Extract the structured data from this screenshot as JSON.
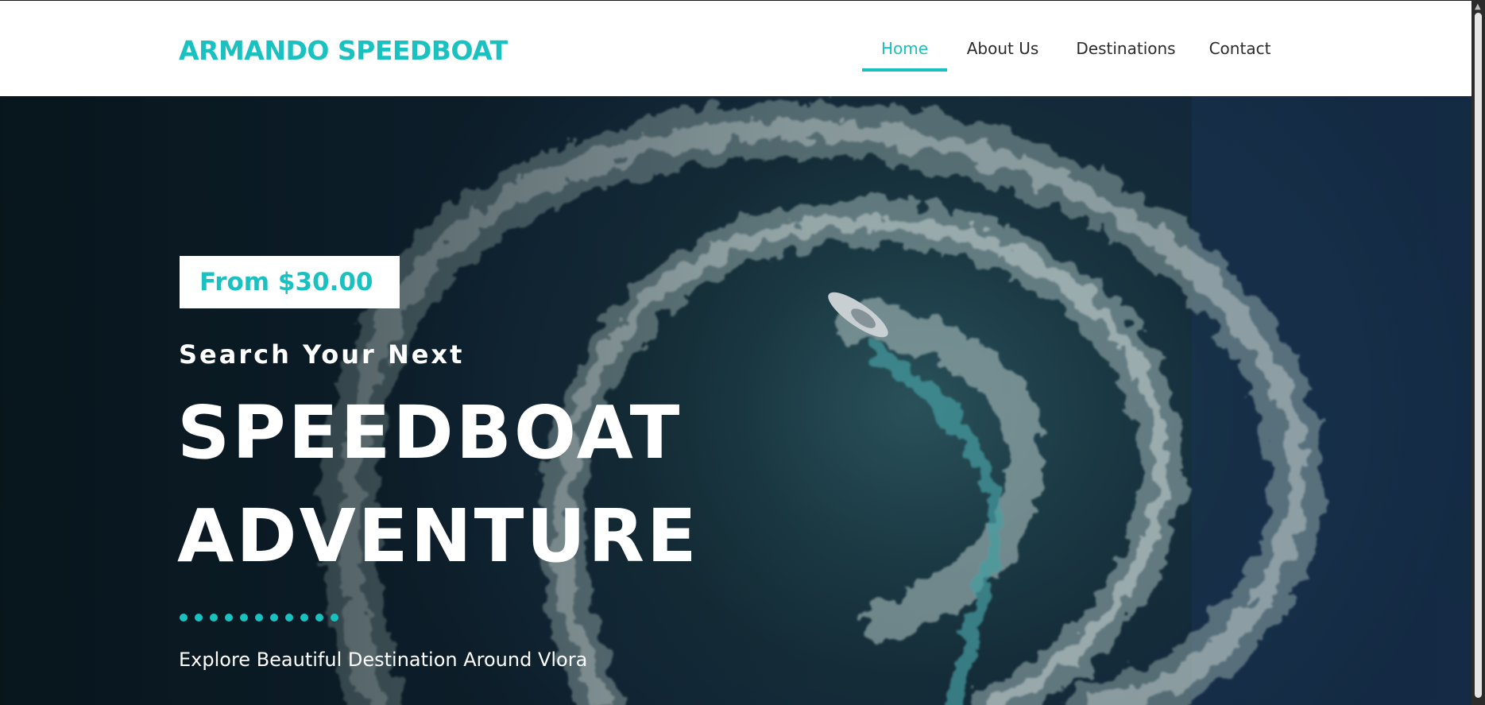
{
  "brand": {
    "name": "ARMANDO SPEEDBOAT",
    "color": "#19c2c0"
  },
  "nav": {
    "items": [
      {
        "label": "Home",
        "active": true
      },
      {
        "label": "About Us",
        "active": false
      },
      {
        "label": "Destinations",
        "active": false
      },
      {
        "label": "Contact",
        "active": false
      }
    ]
  },
  "hero": {
    "price": "From $30.00",
    "subtitle": "Search Your Next",
    "title_line1": "SPEEDBOAT",
    "title_line2": "ADVENTURE",
    "tagline": "Explore Beautiful Destination Around Vlora",
    "dot_count": 11,
    "background_image": "aerial-speedboat-spiral-wake"
  },
  "colors": {
    "accent": "#19c2c0",
    "header_bg": "#ffffff",
    "nav_text": "#2b2b2b",
    "hero_text": "#ffffff"
  }
}
